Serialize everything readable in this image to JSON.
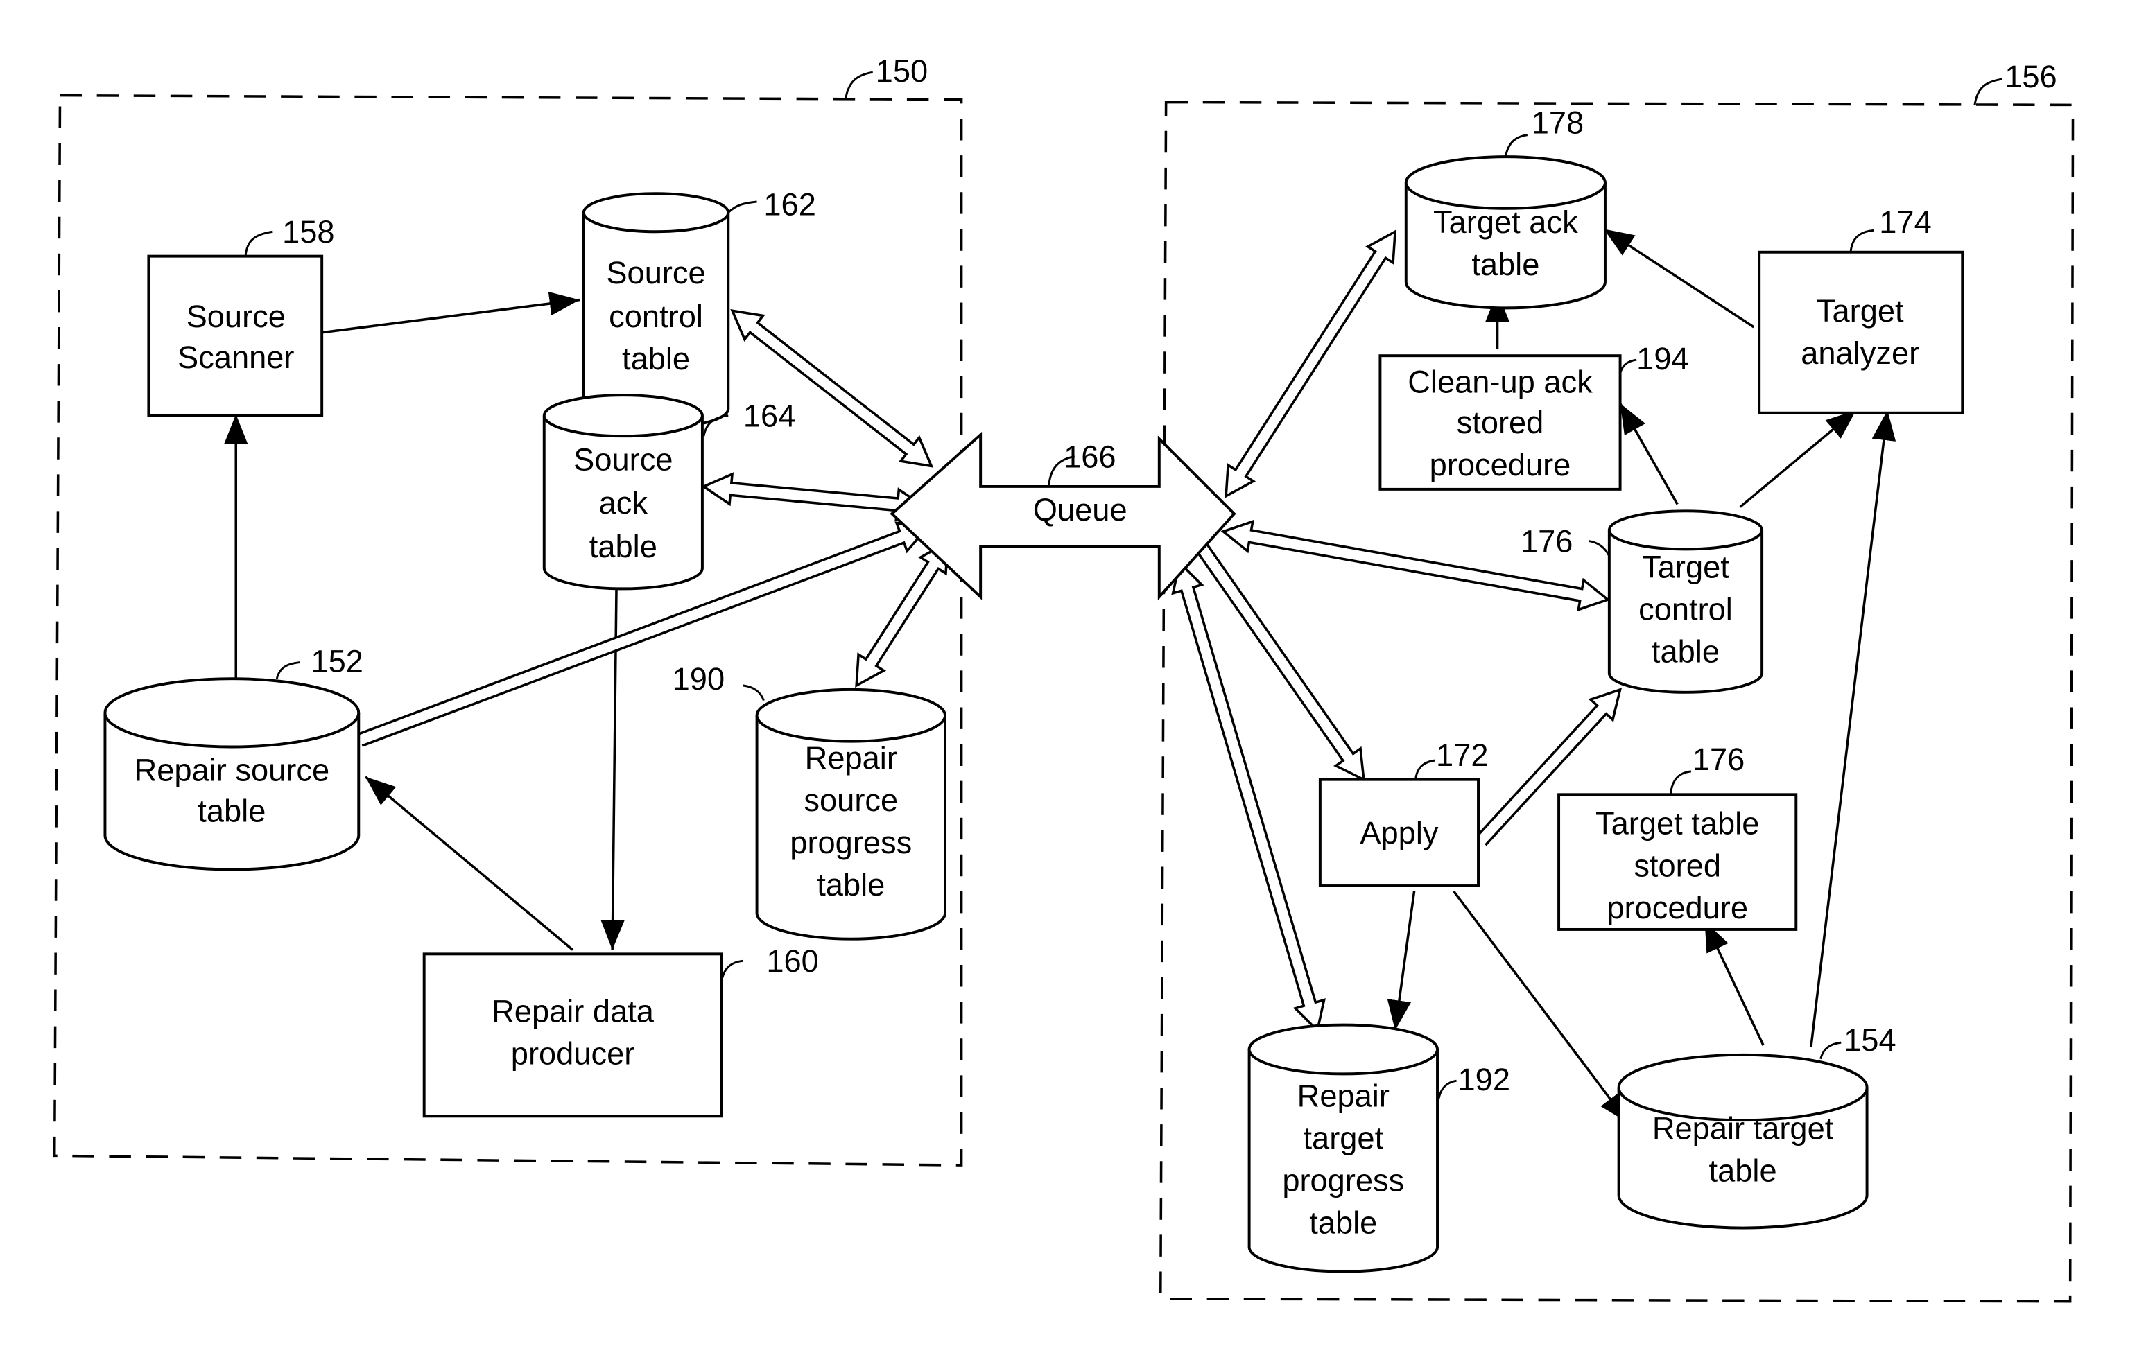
{
  "diagram": {
    "groups": {
      "source_side": {
        "ref": "150"
      },
      "target_side": {
        "ref": "156"
      }
    },
    "queue": {
      "label": "Queue",
      "ref": "166"
    },
    "nodes": {
      "source_scanner": {
        "lines": [
          "Source",
          "Scanner"
        ],
        "ref": "158",
        "shape": "box"
      },
      "source_control_table": {
        "lines": [
          "Source",
          "control",
          "table"
        ],
        "ref": "162",
        "shape": "cylinder"
      },
      "source_ack_table": {
        "lines": [
          "Source",
          "ack",
          "table"
        ],
        "ref": "164",
        "shape": "cylinder"
      },
      "repair_source_table": {
        "lines": [
          "Repair source",
          "table"
        ],
        "ref": "152",
        "shape": "cylinder"
      },
      "repair_source_progress_table": {
        "lines": [
          "Repair",
          "source",
          "progress",
          "table"
        ],
        "ref": "190",
        "shape": "cylinder"
      },
      "repair_data_producer": {
        "lines": [
          "Repair data",
          "producer"
        ],
        "ref": "160",
        "shape": "box"
      },
      "target_ack_table": {
        "lines": [
          "Target ack",
          "table"
        ],
        "ref": "178",
        "shape": "cylinder"
      },
      "target_analyzer": {
        "lines": [
          "Target",
          "analyzer"
        ],
        "ref": "174",
        "shape": "box"
      },
      "cleanup_ack_stored_procedure": {
        "lines": [
          "Clean-up ack",
          "stored",
          "procedure"
        ],
        "ref": "194",
        "shape": "box"
      },
      "target_control_table": {
        "lines": [
          "Target",
          "control",
          "table"
        ],
        "ref": "176",
        "shape": "cylinder"
      },
      "apply": {
        "lines": [
          "Apply"
        ],
        "ref": "172",
        "shape": "box"
      },
      "target_table_stored_procedure": {
        "lines": [
          "Target table",
          "stored",
          "procedure"
        ],
        "ref": "176",
        "shape": "box"
      },
      "repair_target_progress_table": {
        "lines": [
          "Repair",
          "target",
          "progress",
          "table"
        ],
        "ref": "192",
        "shape": "cylinder"
      },
      "repair_target_table": {
        "lines": [
          "Repair target",
          "table"
        ],
        "ref": "154",
        "shape": "cylinder"
      }
    },
    "edges": [
      {
        "from": "source_scanner",
        "to": "source_control_table",
        "style": "line-arrow"
      },
      {
        "from": "repair_source_table",
        "to": "source_scanner",
        "style": "line-arrow"
      },
      {
        "from": "source_ack_table",
        "to": "repair_data_producer",
        "style": "line-arrow"
      },
      {
        "from": "repair_data_producer",
        "to": "repair_source_table",
        "style": "line-arrow"
      },
      {
        "from": "source_control_table",
        "to": "queue",
        "style": "hollow-double"
      },
      {
        "from": "source_ack_table",
        "to": "queue",
        "style": "hollow-double"
      },
      {
        "from": "repair_source_table",
        "to": "queue",
        "style": "hollow-single"
      },
      {
        "from": "repair_source_progress_table",
        "to": "queue",
        "style": "hollow-double"
      },
      {
        "from": "queue",
        "to": "target_ack_table",
        "style": "hollow-double"
      },
      {
        "from": "queue",
        "to": "target_control_table",
        "style": "hollow-double"
      },
      {
        "from": "queue",
        "to": "apply",
        "style": "hollow-single"
      },
      {
        "from": "queue",
        "to": "repair_target_progress_table",
        "style": "hollow-double"
      },
      {
        "from": "apply",
        "to": "target_control_table",
        "style": "hollow-single"
      },
      {
        "from": "target_analyzer",
        "to": "target_ack_table",
        "style": "line-arrow"
      },
      {
        "from": "cleanup_ack_stored_procedure",
        "to": "target_ack_table",
        "style": "line-arrow"
      },
      {
        "from": "target_control_table",
        "to": "cleanup_ack_stored_procedure",
        "style": "line-arrow"
      },
      {
        "from": "target_control_table",
        "to": "target_analyzer",
        "style": "line-arrow"
      },
      {
        "from": "repair_target_table",
        "to": "target_analyzer",
        "style": "line-arrow"
      },
      {
        "from": "repair_target_table",
        "to": "target_table_stored_procedure",
        "style": "line-arrow"
      },
      {
        "from": "apply",
        "to": "repair_target_progress_table",
        "style": "line-arrow"
      },
      {
        "from": "apply",
        "to": "repair_target_table",
        "style": "line-arrow"
      }
    ]
  }
}
